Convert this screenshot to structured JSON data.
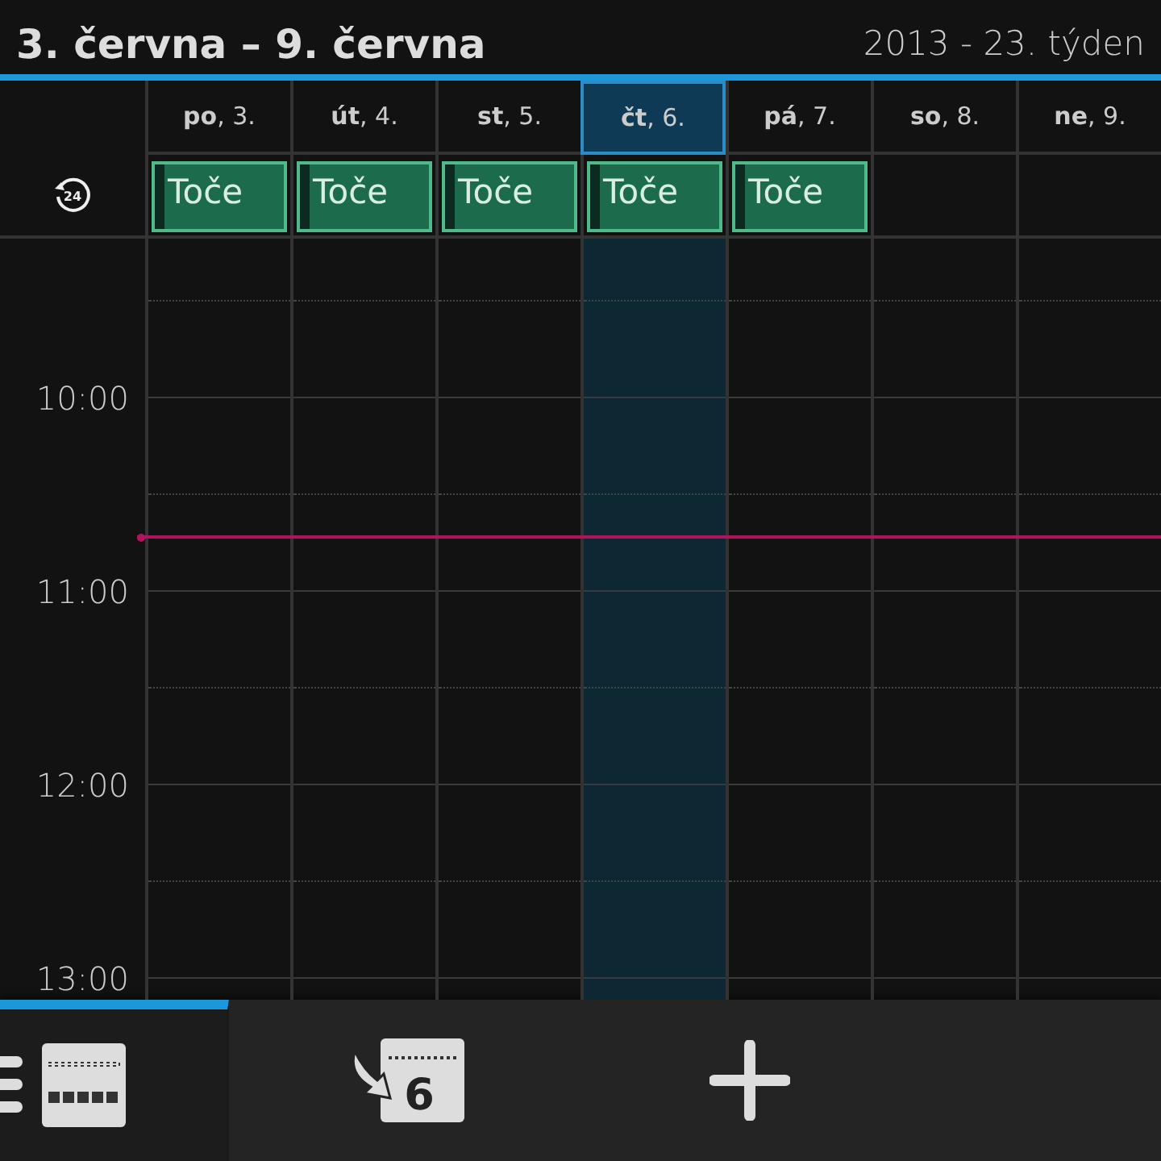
{
  "header": {
    "title": "3. června – 9. června",
    "week": "2013 - 23. týden"
  },
  "days": [
    {
      "label": "**po**, 3.",
      "selected": false,
      "events": [
        "Toče"
      ]
    },
    {
      "label": "**út**, 4.",
      "selected": false,
      "events": [
        "Toče"
      ]
    },
    {
      "label": "**st**, 5.",
      "selected": false,
      "events": [
        "Toče"
      ]
    },
    {
      "label": "**čt**, 6.",
      "selected": true,
      "events": [
        "Toče"
      ]
    },
    {
      "label": "**pá**, 7.",
      "selected": false,
      "events": [
        "Toče"
      ]
    },
    {
      "label": "**so**, 8.",
      "selected": false
    },
    {
      "label": "**ne**, 9.",
      "selected": false
    }
  ],
  "allday_icon_label": "24",
  "times": [
    "10:00",
    "11:00",
    "12:00",
    "13:00"
  ],
  "toolbar": [
    {
      "kind": "view",
      "selected": true
    },
    {
      "kind": "today",
      "label": "6"
    },
    {
      "kind": "add"
    }
  ]
}
